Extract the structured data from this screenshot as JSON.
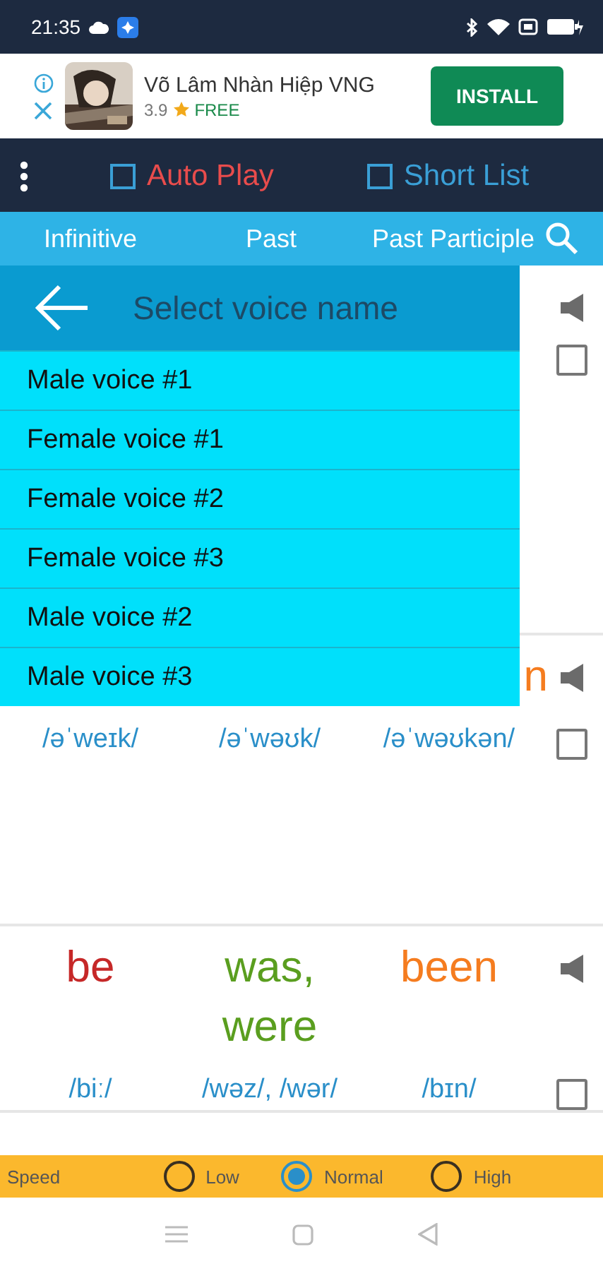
{
  "status_bar": {
    "time": "21:35"
  },
  "ad": {
    "title": "Võ Lâm Nhàn Hiệp VNG",
    "rating": "3.9",
    "price": "FREE",
    "button": "INSTALL"
  },
  "toolbar": {
    "options": [
      {
        "label": "Auto Play",
        "checked": false,
        "color": "#e84c4c"
      },
      {
        "label": "Short List",
        "checked": false,
        "color": "#3a9fd6"
      }
    ]
  },
  "columns": [
    "Infinitive",
    "Past",
    "Past Participle"
  ],
  "rows": [
    {
      "kind": "covered",
      "checked": false
    },
    {
      "kind": "covered",
      "participle": "n",
      "ipa": [
        "/əˈweɪk/",
        "/əˈwəʊk/",
        "/əˈwəʊkən/"
      ],
      "checked": false
    },
    {
      "kind": "full",
      "words": [
        "be",
        "was, were",
        "been"
      ],
      "ipa": [
        "/biː/",
        "/wəz/, /wər/",
        "/bɪn/"
      ],
      "checked": false
    }
  ],
  "dialog": {
    "title": "Select voice name",
    "items": [
      "Male voice #1",
      "Female voice #1",
      "Female voice #2",
      "Female voice #3",
      "Male voice #2",
      "Male voice #3"
    ]
  },
  "speed": {
    "label": "Speed",
    "options": [
      {
        "label": "Low",
        "selected": false
      },
      {
        "label": "Normal",
        "selected": true
      },
      {
        "label": "High",
        "selected": false
      }
    ]
  }
}
